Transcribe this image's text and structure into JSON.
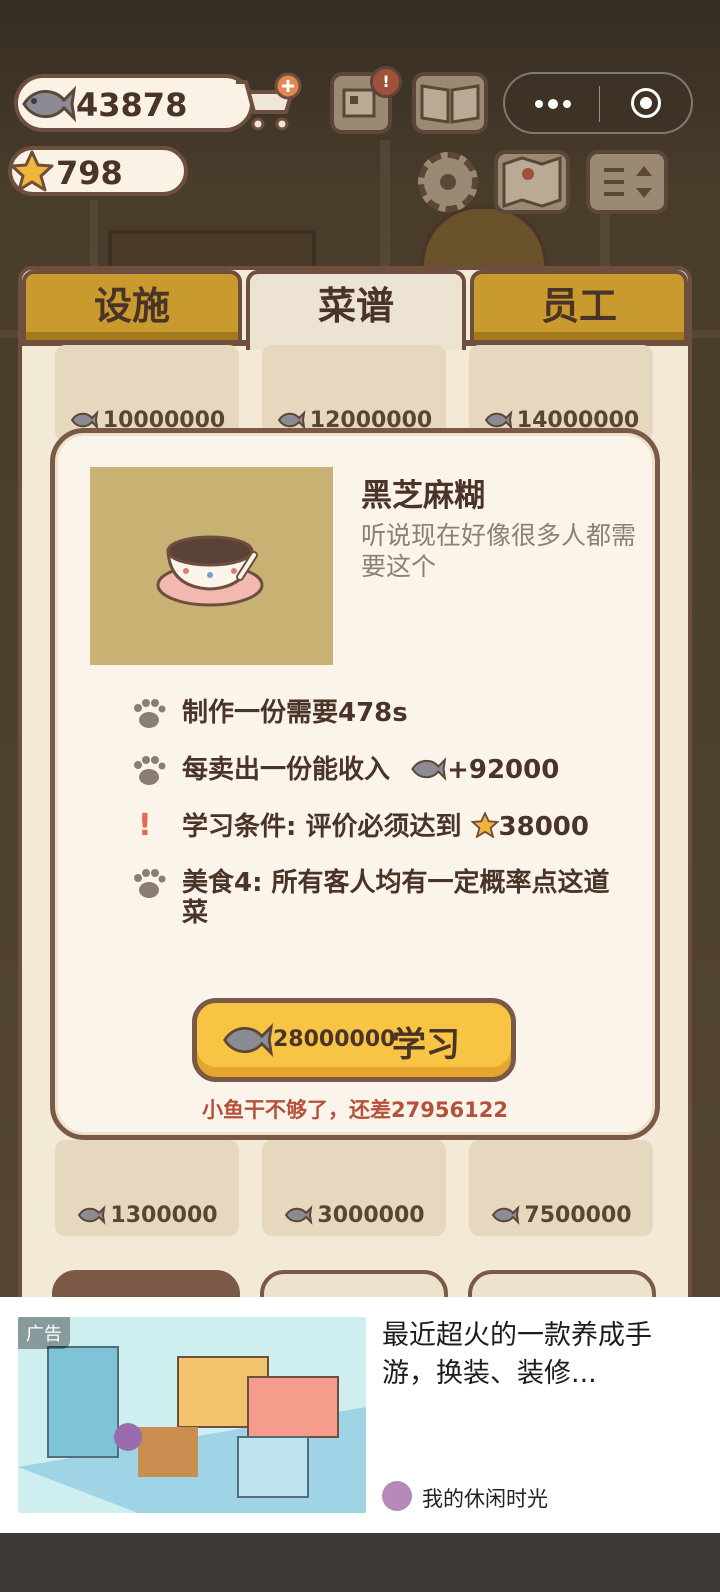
{
  "hud": {
    "fish_count": "43878",
    "star_count": "798"
  },
  "tabs": [
    {
      "label": "设施",
      "active": false
    },
    {
      "label": "菜谱",
      "active": true
    },
    {
      "label": "员工",
      "active": false
    }
  ],
  "recipe_cards_top": [
    {
      "price": "10000000"
    },
    {
      "price": "12000000"
    },
    {
      "price": "14000000"
    }
  ],
  "recipe_cards_bottom": [
    {
      "price": "1300000"
    },
    {
      "price": "3000000"
    },
    {
      "price": "7500000"
    }
  ],
  "modal": {
    "dish_name": "黑芝麻糊",
    "description": "听说现在好像很多人都需要这个",
    "make_time": "制作一份需要478s",
    "income_prefix": "每卖出一份能收入",
    "income_value": "+92000",
    "condition_prefix": "学习条件: 评价必须达到",
    "condition_value": "38000",
    "special": "美食4: 所有客人均有一定概率点这道菜",
    "learn_cost": "28000000",
    "learn_label": "学习",
    "shortage_text": "小鱼干不够了，还差27956122"
  },
  "ad": {
    "tag": "广告",
    "title": "最近超火的一款养成手游，换装、装修...",
    "source": "我的休闲时光"
  },
  "colors": {
    "accent": "#f7c444",
    "border": "#6e4e3c",
    "tab_gold": "#c99b2f",
    "warning": "#b4513b"
  }
}
